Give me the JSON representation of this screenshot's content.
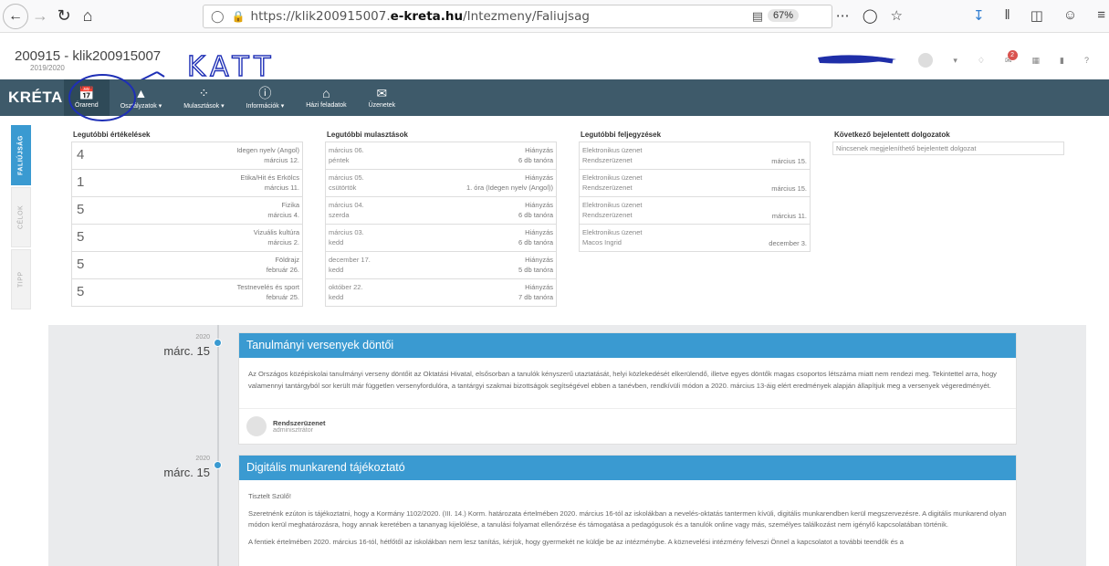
{
  "browser": {
    "url_prefix": "https://klik200915007.",
    "url_domain": "e-kreta.hu",
    "url_path": "/Intezmeny/Faliujsag",
    "zoom": "67%"
  },
  "header": {
    "school": "200915 - klik200915007",
    "year": "2019/2020",
    "annotation": "KATT",
    "mail_badge": "2"
  },
  "nav": {
    "logo": "KRÉTA",
    "items": [
      {
        "label": "Órarend",
        "icon": "calendar-check-icon"
      },
      {
        "label": "Osztályzatok ▾",
        "icon": "graduation-cap-icon"
      },
      {
        "label": "Mulasztások ▾",
        "icon": "spinner-icon"
      },
      {
        "label": "Információk ▾",
        "icon": "info-icon"
      },
      {
        "label": "Házi feladatok",
        "icon": "home-icon"
      },
      {
        "label": "Üzenetek",
        "icon": "envelope-icon"
      }
    ]
  },
  "sidetabs": [
    "FALIÚJSÁG",
    "CÉLOK",
    "TIPP"
  ],
  "widgets": {
    "grades": {
      "title": "Legutóbbi értékelések",
      "rows": [
        {
          "grade": "4",
          "subject": "Idegen nyelv (Angol)",
          "date": "március 12."
        },
        {
          "grade": "1",
          "subject": "Etika/Hit és Erkölcs",
          "date": "március 11."
        },
        {
          "grade": "5",
          "subject": "Fizika",
          "date": "március 4."
        },
        {
          "grade": "5",
          "subject": "Vizuális kultúra",
          "date": "március 2."
        },
        {
          "grade": "5",
          "subject": "Földrajz",
          "date": "február 26."
        },
        {
          "grade": "5",
          "subject": "Testnevelés és sport",
          "date": "február 25."
        }
      ]
    },
    "absences": {
      "title": "Legutóbbi mulasztások",
      "rows": [
        {
          "date": "március 06.",
          "day": "péntek",
          "type": "Hiányzás",
          "detail": "6 db tanóra"
        },
        {
          "date": "március 05.",
          "day": "csütörtök",
          "type": "Hiányzás",
          "detail": "1. óra (Idegen nyelv (Angol))"
        },
        {
          "date": "március 04.",
          "day": "szerda",
          "type": "Hiányzás",
          "detail": "6 db tanóra"
        },
        {
          "date": "március 03.",
          "day": "kedd",
          "type": "Hiányzás",
          "detail": "6 db tanóra"
        },
        {
          "date": "december 17.",
          "day": "kedd",
          "type": "Hiányzás",
          "detail": "5 db tanóra"
        },
        {
          "date": "október 22.",
          "day": "kedd",
          "type": "Hiányzás",
          "detail": "7 db tanóra"
        }
      ]
    },
    "notes": {
      "title": "Legutóbbi feljegyzések",
      "rows": [
        {
          "type": "Elektronikus üzenet",
          "from": "Rendszerüzenet",
          "date": "március 15."
        },
        {
          "type": "Elektronikus üzenet",
          "from": "Rendszerüzenet",
          "date": "március 15."
        },
        {
          "type": "Elektronikus üzenet",
          "from": "Rendszerüzenet",
          "date": "március 11."
        },
        {
          "type": "Elektronikus üzenet",
          "from": "Macos Ingrid",
          "date": "december 3."
        }
      ]
    },
    "tests": {
      "title": "Következő bejelentett dolgozatok",
      "empty": "Nincsenek megjeleníthető bejelentett dolgozat"
    }
  },
  "timeline": [
    {
      "year": "2020",
      "date": "márc. 15",
      "title": "Tanulmányi versenyek döntői",
      "paragraphs": [
        "Az Országos középiskolai tanulmányi verseny döntőit az Oktatási Hivatal, elsősorban a tanulók kényszerű utaztatását, helyi közlekedését elkerülendő, illetve egyes döntők magas csoportos létszáma miatt nem rendezi meg. Tekintettel arra, hogy valamennyi tantárgyból sor került már független versenyfordulóra, a tantárgyi szakmai bizottságok segítségével ebben a tanévben, rendkívüli módon a 2020. március 13-áig elért eredmények alapján állapítjuk meg a versenyek végeredményét."
      ],
      "author": "Rendszerüzenet",
      "role": "adminisztrátor"
    },
    {
      "year": "2020",
      "date": "márc. 15",
      "title": "Digitális munkarend tájékoztató",
      "paragraphs": [
        "Tisztelt Szülő!",
        "Szeretnénk ezúton is tájékoztatni, hogy a Kormány 1102/2020. (III. 14.) Korm. határozata értelmében 2020. március 16-tól az iskolákban a nevelés-oktatás tantermen kívüli, digitális munkarendben kerül megszervezésre. A digitális munkarend olyan módon kerül meghatározásra, hogy annak keretében a tananyag kijelölése, a tanulási folyamat ellenőrzése és támogatása a pedagógusok és a tanulók online vagy más, személyes találkozást nem igénylő kapcsolatában történik.",
        "A fentiek értelmében 2020. március 16-tól, hétfőtől az iskolákban nem lesz tanítás, kérjük, hogy gyermekét ne küldje be az intézménybe. A köznevelési intézmény felveszi Önnel a kapcsolatot a további teendők és a"
      ],
      "author": "",
      "role": ""
    }
  ]
}
